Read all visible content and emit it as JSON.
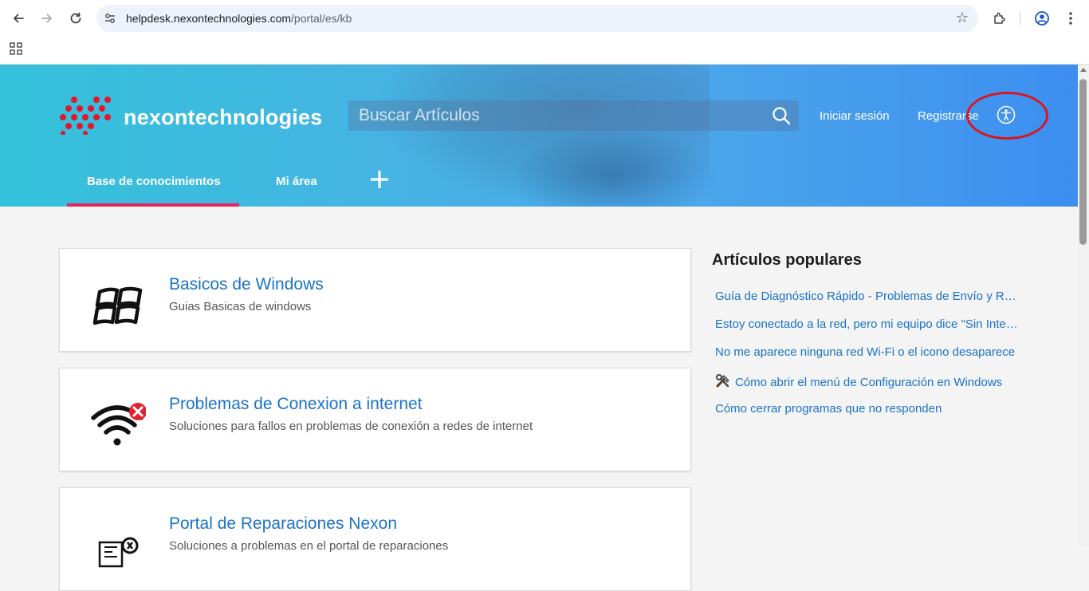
{
  "browser": {
    "url_host": "helpdesk.nexontechnologies.com",
    "url_path": "/portal/es/kb"
  },
  "header": {
    "brand": "nexontechnologies",
    "search_placeholder": "Buscar Artículos",
    "login": "Iniciar sesión",
    "register": "Registrarse",
    "tabs": [
      {
        "label": "Base de conocimientos",
        "active": true
      },
      {
        "label": "Mi área",
        "active": false
      }
    ]
  },
  "cards": [
    {
      "title": "Basicos de Windows",
      "description": "Guias Basicas de windows",
      "icon": "windows-icon"
    },
    {
      "title": "Problemas de Conexion a internet",
      "description": "Soluciones para fallos en problemas de conexión a redes de internet",
      "icon": "wifi-error-icon"
    },
    {
      "title": "Portal de Reparaciones Nexon",
      "description": "Soluciones a problemas en el portal de reparaciones",
      "icon": "circuit-repair-icon"
    }
  ],
  "popular": {
    "title": "Artículos populares",
    "items": [
      "Guía de Diagnóstico Rápido - Problemas de Envío y Recepción",
      "Estoy conectado a la red, pero mi equipo dice \"Sin Internet\"",
      "No me aparece ninguna red Wi-Fi o el icono desaparece",
      "Cómo abrir el menú de Configuración en Windows",
      "Cómo cerrar programas que no responden"
    ]
  },
  "colors": {
    "accent_underline": "#e6235b",
    "link": "#1a73c8",
    "annotation": "#d9161f"
  }
}
